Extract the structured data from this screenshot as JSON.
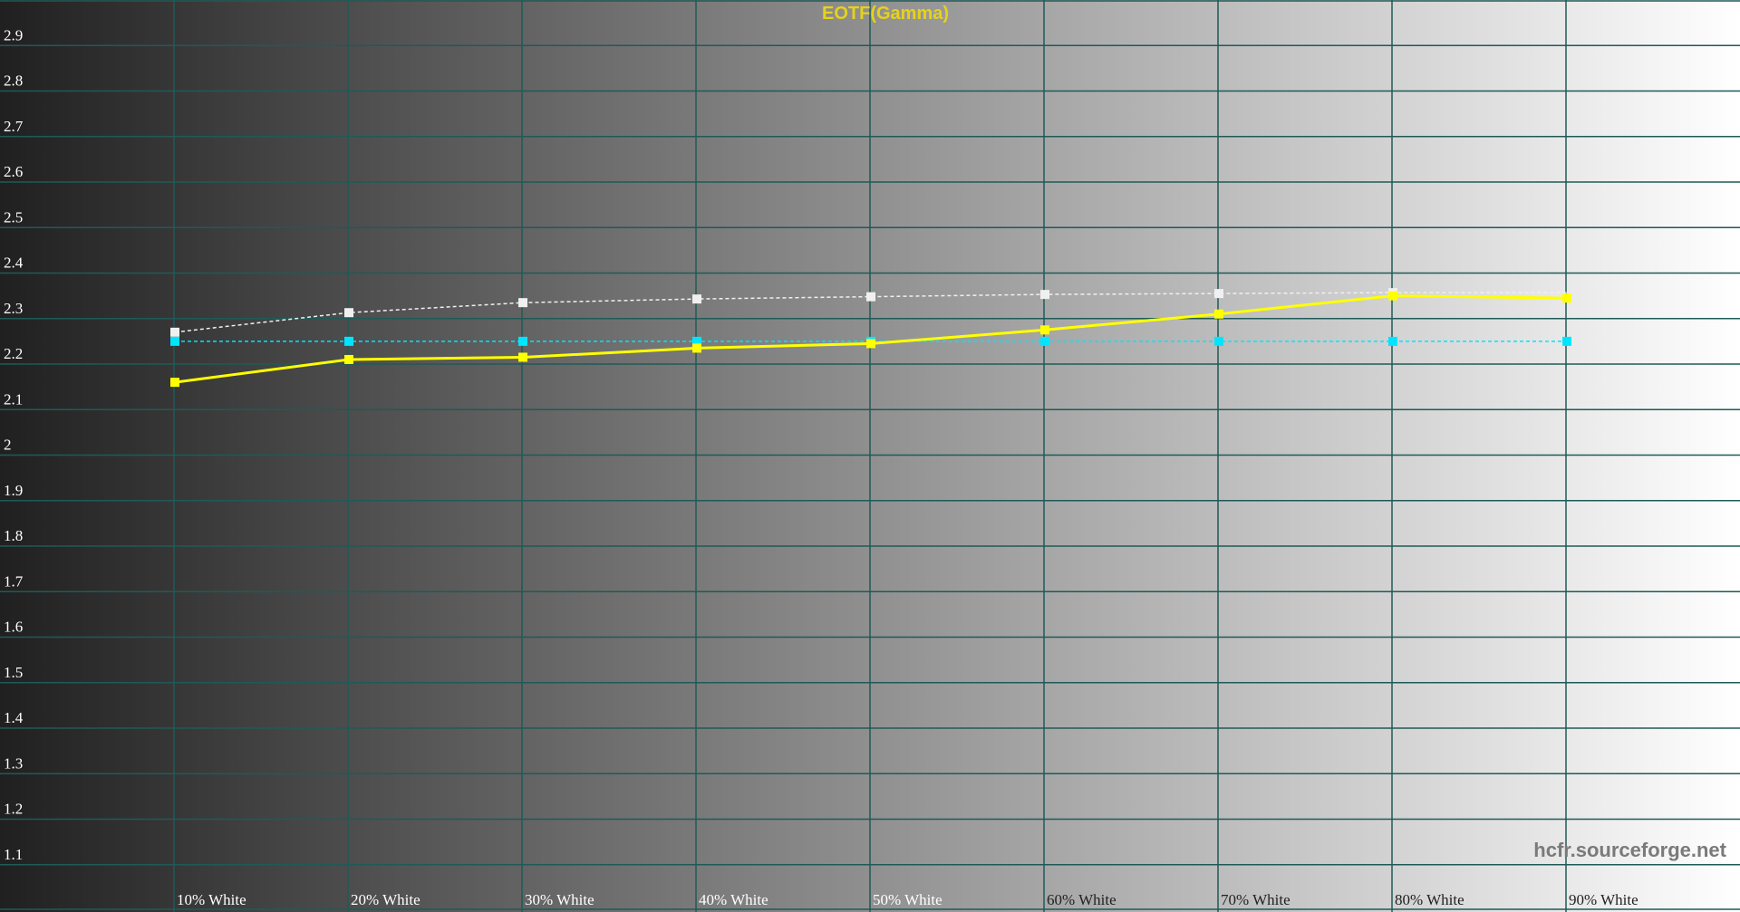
{
  "chart_data": {
    "type": "line",
    "title": "EOTF(Gamma)",
    "categories": [
      "10% White",
      "20% White",
      "30% White",
      "40% White",
      "50% White",
      "60% White",
      "70% White",
      "80% White",
      "90% White"
    ],
    "ylim": [
      1.0,
      3.0
    ],
    "yticks": [
      1.1,
      1.2,
      1.3,
      1.4,
      1.5,
      1.6,
      1.7,
      1.8,
      1.9,
      2,
      2.1,
      2.2,
      2.3,
      2.4,
      2.5,
      2.6,
      2.7,
      2.8,
      2.9
    ],
    "ytick_labels": [
      "1.1",
      "1.2",
      "1.3",
      "1.4",
      "1.5",
      "1.6",
      "1.7",
      "1.8",
      "1.9",
      "2",
      "2.1",
      "2.2",
      "2.3",
      "2.4",
      "2.5",
      "2.6",
      "2.7",
      "2.8",
      "2.9"
    ],
    "grid": true,
    "background": "grayscale gradient, dark to light",
    "series": [
      {
        "values": [
          2.16,
          2.21,
          2.215,
          2.235,
          2.245,
          2.275,
          2.31,
          2.35,
          2.345
        ],
        "color": "#ffff00",
        "style": "solid"
      },
      {
        "values": [
          2.27,
          2.313,
          2.335,
          2.343,
          2.348,
          2.353,
          2.355,
          2.357,
          2.357
        ],
        "color": "#f0f0f0",
        "style": "dashed",
        "markers_shown": 8
      },
      {
        "values": [
          2.25,
          2.25,
          2.25,
          2.25,
          2.25,
          2.25,
          2.25,
          2.25,
          2.25
        ],
        "color": "#00e5ff",
        "style": "dashed"
      }
    ],
    "title_color": "#e6d21a",
    "grid_color": "#1f5a58",
    "watermark": "hcfr.sourceforge.net",
    "watermark_color": "#7a7a7a"
  }
}
